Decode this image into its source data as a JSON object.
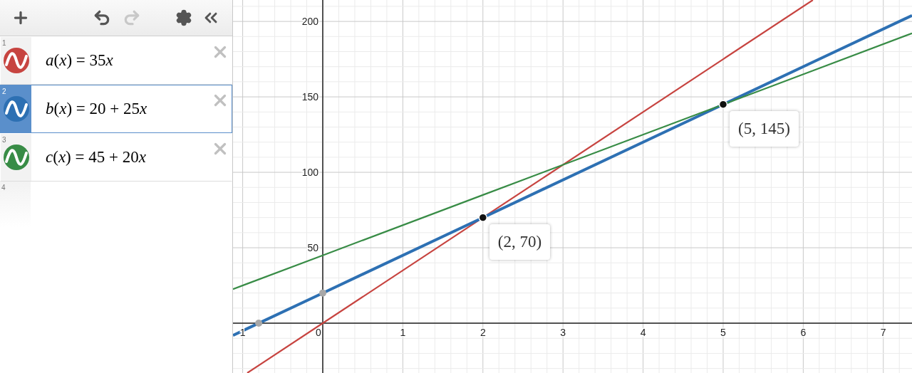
{
  "toolbar": {
    "redo_disabled": true
  },
  "expressions": [
    {
      "index": "1",
      "formula": "a(x) = 35x",
      "color": "#c74440",
      "selected": false
    },
    {
      "index": "2",
      "formula": "b(x) = 20 + 25x",
      "color": "#2d70b3",
      "selected": true
    },
    {
      "index": "3",
      "formula": "c(x) = 45 + 20x",
      "color": "#388c46",
      "selected": false
    },
    {
      "index": "4"
    }
  ],
  "graph": {
    "chart_data": {
      "type": "line",
      "grid": true,
      "x": [
        -1.121,
        -0.943,
        0,
        2,
        5,
        6.12,
        7.358
      ],
      "series": [
        {
          "color": "#c74440",
          "values": [
            null,
            -33,
            0,
            70,
            175,
            214.2,
            null
          ]
        },
        {
          "color": "#2d70b3",
          "values": [
            -8.03,
            -3.58,
            20,
            70,
            145,
            173,
            203.95
          ]
        },
        {
          "color": "#388c46",
          "values": [
            22.58,
            26.14,
            45,
            85,
            145,
            167.4,
            192.16
          ]
        }
      ],
      "xlim": [
        -1.121,
        7.358
      ],
      "ylim": [
        -33,
        214.2
      ],
      "xticks": [
        {
          "value": -1,
          "label": "1"
        },
        {
          "value": 0,
          "label": "0"
        },
        {
          "value": 1,
          "label": "1"
        },
        {
          "value": 2,
          "label": "2"
        },
        {
          "value": 3,
          "label": "3"
        },
        {
          "value": 4,
          "label": "4"
        },
        {
          "value": 5,
          "label": "5"
        },
        {
          "value": 6,
          "label": "6"
        },
        {
          "value": 7,
          "label": "7"
        }
      ],
      "yticks": [
        {
          "value": 50,
          "label": "50"
        },
        {
          "value": 100,
          "label": "100"
        },
        {
          "value": 150,
          "label": "150"
        },
        {
          "value": 200,
          "label": "200"
        }
      ],
      "annotations": [
        {
          "x": 2,
          "y": 70,
          "text": "(2, 70)"
        },
        {
          "x": 5,
          "y": 145,
          "text": "(5, 145)"
        }
      ]
    }
  }
}
